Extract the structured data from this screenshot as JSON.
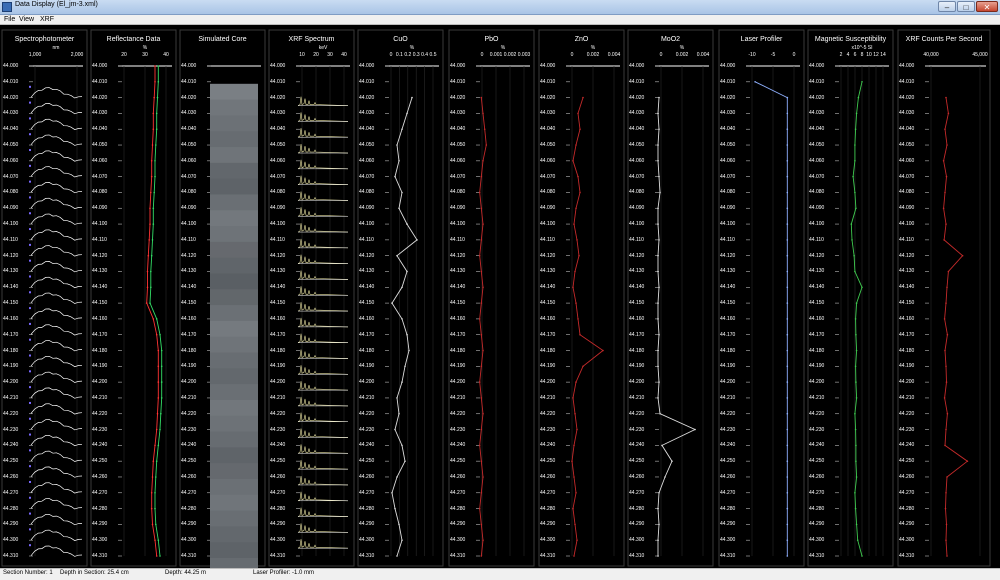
{
  "window": {
    "title": "Data Display (El_jm-3.xml)",
    "minimize": "–",
    "maximize": "□",
    "close": "✕"
  },
  "menu": [
    "File",
    "View",
    "XRF"
  ],
  "depths": [
    "44.000",
    "44.010",
    "44.020",
    "44.030",
    "44.040",
    "44.050",
    "44.060",
    "44.070",
    "44.080",
    "44.090",
    "44.100",
    "44.110",
    "44.120",
    "44.130",
    "44.140",
    "44.150",
    "44.160",
    "44.170",
    "44.180",
    "44.190",
    "44.200",
    "44.210",
    "44.220",
    "44.230",
    "44.240",
    "44.250",
    "44.260",
    "44.270",
    "44.280",
    "44.290",
    "44.300",
    "44.310"
  ],
  "tracks": [
    {
      "key": "spectrophotometer",
      "title": "Spectrophotometer",
      "unit": "nm",
      "ticks": [
        "1,000",
        "2,000"
      ]
    },
    {
      "key": "reflectance",
      "title": "Reflectance Data",
      "unit": "%",
      "ticks": [
        "20",
        "30",
        "40"
      ]
    },
    {
      "key": "simulated_core",
      "title": "Simulated Core",
      "unit": "",
      "ticks": []
    },
    {
      "key": "xrf_spectrum",
      "title": "XRF Spectrum",
      "unit": "keV",
      "ticks": [
        "10",
        "20",
        "30",
        "40"
      ]
    },
    {
      "key": "cuo",
      "title": "CuO",
      "unit": "%",
      "ticks": [
        "0",
        "0.1",
        "0.2",
        "0.3",
        "0.4",
        "0.5"
      ]
    },
    {
      "key": "pbo",
      "title": "PbO",
      "unit": "%",
      "ticks": [
        "0",
        "0.001",
        "0.002",
        "0.003"
      ]
    },
    {
      "key": "zno",
      "title": "ZnO",
      "unit": "%",
      "ticks": [
        "0",
        "0.002",
        "0.004"
      ]
    },
    {
      "key": "moo2",
      "title": "MoO2",
      "unit": "%",
      "ticks": [
        "0",
        "0.002",
        "0.004"
      ]
    },
    {
      "key": "laser",
      "title": "Laser Profiler",
      "unit": "",
      "ticks": [
        "-10",
        "-5",
        "0"
      ]
    },
    {
      "key": "magsus",
      "title": "Magnetic Susceptibility",
      "unit": "x10^-5 SI",
      "ticks": [
        "2",
        "4",
        "6",
        "8",
        "10",
        "12",
        "14"
      ]
    },
    {
      "key": "xrf_cps",
      "title": "XRF Counts Per Second",
      "unit": "",
      "ticks": [
        "40,000",
        "45,000"
      ]
    }
  ],
  "chart_data": [
    {
      "type": "line",
      "title": "Reflectance Data",
      "xlabel": "%",
      "xlim": [
        15,
        45
      ],
      "series": [
        {
          "color": "#ff3333",
          "values": [
            36,
            36,
            35.5,
            35,
            35,
            34.5,
            34,
            34,
            33.5,
            33,
            33,
            32.5,
            32,
            31.5,
            31.5,
            31,
            35,
            37,
            38,
            38,
            38,
            38,
            37.5,
            37,
            36,
            35,
            34.5,
            34,
            34,
            34.5,
            36,
            37
          ]
        },
        {
          "color": "#33dd66",
          "values": [
            38,
            38,
            37.5,
            37,
            37,
            36.5,
            36,
            36,
            35.5,
            35,
            35,
            34.5,
            34,
            33.5,
            33.5,
            33,
            37,
            39,
            40,
            40,
            40,
            40,
            39.5,
            39,
            38,
            37,
            36.5,
            36,
            36,
            36.5,
            38,
            39
          ]
        }
      ]
    },
    {
      "type": "line",
      "title": "CuO",
      "xlabel": "%",
      "xlim": [
        0,
        0.5
      ],
      "series": [
        {
          "color": "#dddddd",
          "values": [
            null,
            null,
            0.25,
            0.2,
            0.15,
            0.1,
            0.12,
            0.08,
            0.15,
            0.12,
            0.2,
            0.3,
            0.1,
            0.2,
            0.15,
            0.05,
            0.15,
            0.2,
            0.22,
            0.18,
            0.15,
            0.1,
            0.12,
            0.08,
            0.15,
            0.18,
            0.1,
            0.05,
            0.08,
            0.12,
            0.15,
            0.1
          ]
        }
      ]
    },
    {
      "type": "line",
      "title": "PbO",
      "xlabel": "%",
      "xlim": [
        0,
        0.003
      ],
      "series": [
        {
          "color": "#c42a2a",
          "values": [
            null,
            null,
            0.0002,
            0.0003,
            0.0004,
            0.0005,
            0.0003,
            0.0002,
            0.0001,
            0.0002,
            0.0003,
            0.0002,
            0.0001,
            0.0002,
            0.0003,
            0.0002,
            0.0001,
            0.0002,
            0.0003,
            0.0002,
            0.0001,
            0.0002,
            0.0003,
            0.0002,
            0.0001,
            0.0002,
            0.0003,
            0.0002,
            0.0001,
            0.0002,
            0.0003,
            0.0002
          ]
        }
      ]
    },
    {
      "type": "line",
      "title": "ZnO",
      "xlabel": "%",
      "xlim": [
        0,
        0.005
      ],
      "series": [
        {
          "color": "#c42a2a",
          "values": [
            null,
            null,
            0.0015,
            0.001,
            0.0012,
            0.0008,
            0.0005,
            0.001,
            0.0012,
            0.0008,
            0.0006,
            0.0009,
            0.0011,
            0.0007,
            0.0005,
            0.0008,
            0.001,
            0.0012,
            0.0035,
            0.0015,
            0.0008,
            0.0005,
            0.0007,
            0.0009,
            0.0006,
            0.0004,
            0.0006,
            0.0008,
            0.0005,
            0.0007,
            0.0009,
            0.0006
          ]
        }
      ]
    },
    {
      "type": "line",
      "title": "MoO2",
      "xlabel": "%",
      "xlim": [
        0,
        0.005
      ],
      "series": [
        {
          "color": "#dddddd",
          "values": [
            null,
            null,
            0.0002,
            0.0001,
            0.0002,
            0.0001,
            0.0001,
            0.0002,
            0.0003,
            0.0001,
            0.0001,
            0.0002,
            0.0001,
            0.0001,
            0.0002,
            0.0001,
            0.0001,
            0.0002,
            0.0001,
            0.0001,
            0.0002,
            0.0001,
            0.0003,
            0.0038,
            0.0005,
            0.0015,
            0.0008,
            0.0002,
            0.0001,
            0.0002,
            0.0001,
            0.0001
          ]
        }
      ]
    },
    {
      "type": "line",
      "title": "Laser Profiler",
      "xlim": [
        -12,
        2
      ],
      "series": [
        {
          "color": "#8fb0ff",
          "values": [
            null,
            -10,
            -1,
            -1,
            -1,
            -1,
            -1,
            -1,
            -1,
            -1,
            -1,
            -1,
            -1,
            -1,
            -1,
            -1,
            -1,
            -1,
            -1,
            -1,
            -1,
            -1,
            -1,
            -1,
            -1,
            -1,
            -1,
            -1,
            -1,
            -1,
            -1,
            -1
          ]
        }
      ]
    },
    {
      "type": "line",
      "title": "Magnetic Susceptibility",
      "xlabel": "x10^-5 SI",
      "xlim": [
        1,
        15
      ],
      "series": [
        {
          "color": "#3fc94f",
          "values": [
            null,
            8,
            7,
            6.5,
            6.2,
            6,
            6,
            5.5,
            6,
            6.3,
            5,
            5.2,
            5.8,
            6,
            8,
            6.5,
            6.2,
            6.3,
            6.5,
            6.2,
            6.3,
            6.5,
            6,
            6.2,
            6.3,
            6.3,
            6.5,
            6,
            6.2,
            6.5,
            6.8,
            8
          ]
        }
      ]
    },
    {
      "type": "line",
      "title": "XRF Counts Per Second",
      "xlim": [
        36000,
        48000
      ],
      "series": [
        {
          "color": "#c42a2a",
          "values": [
            null,
            null,
            40000,
            40500,
            39800,
            40200,
            39500,
            40100,
            39800,
            39500,
            40000,
            39600,
            43500,
            40500,
            40200,
            40000,
            39700,
            40300,
            39800,
            40000,
            40100,
            39700,
            40300,
            40000,
            39800,
            44500,
            40200,
            40000,
            39900,
            40100,
            40000,
            40200
          ]
        }
      ]
    }
  ],
  "status": {
    "section": "Section Number: 1",
    "depth_in_section": "Depth in Section: 25.4 cm",
    "depth": "Depth: 44.25 m",
    "laser": "Laser Profiler: -1.0 mm"
  }
}
